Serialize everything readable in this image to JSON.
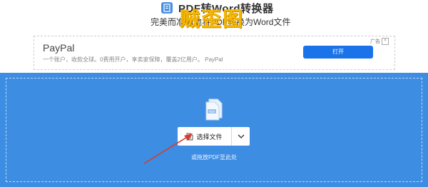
{
  "header": {
    "title": "PDF转Word转换器",
    "subtitle": "完美而准确地将PDF转换为Word文件",
    "watermark": "贼歪图",
    "logo_icon": "document-convert-icon"
  },
  "ad": {
    "brand": "PayPal",
    "text": "一个账户，收款全球。0费用开户，享卖家保障，覆盖2亿用户。 PayPal",
    "cta": "打开",
    "badge": "广告"
  },
  "dropzone": {
    "button_label": "选择文件",
    "hint": "或拖放PDF至此处",
    "file_icon": "pdf-file-icon",
    "dropdown_icon": "chevron-down-icon"
  },
  "colors": {
    "accent": "#3d8de3",
    "cta": "#1a73e8",
    "watermark": "#f5b700",
    "arrow": "#d93a2b"
  }
}
